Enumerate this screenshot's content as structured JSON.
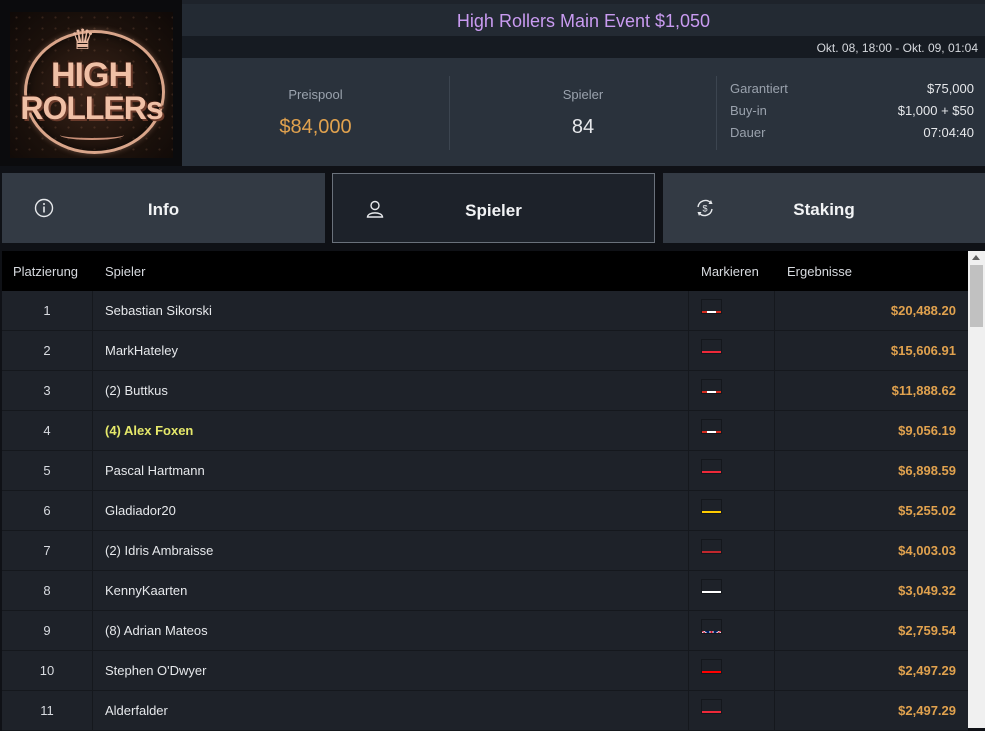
{
  "logo": {
    "line1": "HIGH",
    "line2": "ROLLERs"
  },
  "header": {
    "title": "High Rollers Main Event $1,050",
    "dates": "Okt. 08, 18:00 - Okt. 09, 01:04"
  },
  "stats": {
    "pool_label": "Preispool",
    "pool_value": "$84,000",
    "players_label": "Spieler",
    "players_value": "84",
    "guaranteed_label": "Garantiert",
    "guaranteed_value": "$75,000",
    "buyin_label": "Buy-in",
    "buyin_value": "$1,000 + $50",
    "duration_label": "Dauer",
    "duration_value": "07:04:40"
  },
  "tabs": {
    "info": {
      "label": "Info",
      "icon": "info-icon"
    },
    "spieler": {
      "label": "Spieler",
      "icon": "user-icon"
    },
    "staking": {
      "label": "Staking",
      "icon": "dollar-cycle-icon"
    }
  },
  "table": {
    "headers": {
      "place": "Platzierung",
      "player": "Spieler",
      "mark": "Markieren",
      "result": "Ergebnisse"
    },
    "rows": [
      {
        "place": "1",
        "name": "Sebastian Sikorski",
        "flag": "ca",
        "result": "$20,488.20"
      },
      {
        "place": "2",
        "name": "MarkHateley",
        "flag": "at",
        "result": "$15,606.91"
      },
      {
        "place": "3",
        "name": "(2) Buttkus",
        "flag": "ca",
        "result": "$11,888.62"
      },
      {
        "place": "4",
        "name": "(4) Alex Foxen",
        "flag": "ca",
        "result": "$9,056.19",
        "highlight": true
      },
      {
        "place": "5",
        "name": "Pascal Hartmann",
        "flag": "at",
        "result": "$6,898.59"
      },
      {
        "place": "6",
        "name": "Gladiador20",
        "flag": "ve",
        "result": "$5,255.02"
      },
      {
        "place": "7",
        "name": "(2) Idris Ambraisse",
        "flag": "ma",
        "result": "$4,003.03"
      },
      {
        "place": "8",
        "name": "KennyKaarten",
        "flag": "pl",
        "result": "$3,049.32"
      },
      {
        "place": "9",
        "name": "(8) Adrian Mateos",
        "flag": "gb",
        "result": "$2,759.54"
      },
      {
        "place": "10",
        "name": "Stephen O'Dwyer",
        "flag": "hr",
        "result": "$2,497.29"
      },
      {
        "place": "11",
        "name": "Alderfalder",
        "flag": "at",
        "result": "$2,497.29"
      }
    ]
  },
  "colors": {
    "accent_title": "#c99bf1",
    "gold": "#e1a24e",
    "highlight_name": "#e5e86a"
  }
}
